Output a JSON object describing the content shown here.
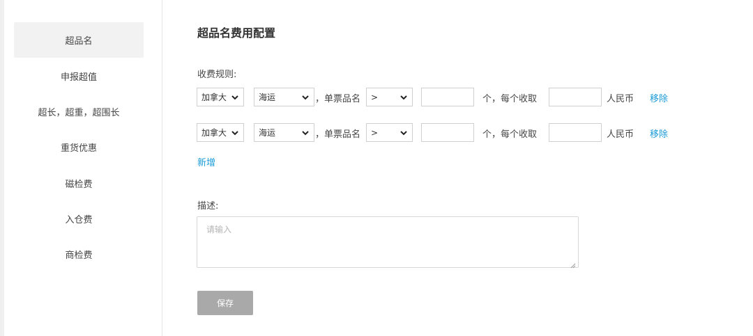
{
  "sidebar": {
    "items": [
      {
        "label": "超品名",
        "active": true
      },
      {
        "label": "申报超值"
      },
      {
        "label": "超长，超重，超围长"
      },
      {
        "label": "重货优惠"
      },
      {
        "label": "磁检费"
      },
      {
        "label": "入仓费"
      },
      {
        "label": "商检费"
      }
    ]
  },
  "main": {
    "title": "超品名费用配置",
    "rules_label": "收费规则:",
    "rules": [
      {
        "country": "加拿大",
        "shipping": "海运",
        "text_single": "，单票品名",
        "operator": ">",
        "count_value": "",
        "text_each": "个，每个收取",
        "fee_value": "",
        "currency": "人民币",
        "remove": "移除"
      },
      {
        "country": "加拿大",
        "shipping": "海运",
        "text_single": "，单票品名",
        "operator": ">",
        "count_value": "",
        "text_each": "个，每个收取",
        "fee_value": "",
        "currency": "人民币",
        "remove": "移除"
      }
    ],
    "add_label": "新增",
    "desc_label": "描述:",
    "desc_placeholder": "请输入",
    "save_label": "保存"
  },
  "colors": {
    "link": "#1a9bd7",
    "save_button": "#a9a9a9",
    "active_nav": "#f2f2f2"
  },
  "icons": [
    "chevron-down-icon",
    "resize-grip-icon"
  ]
}
